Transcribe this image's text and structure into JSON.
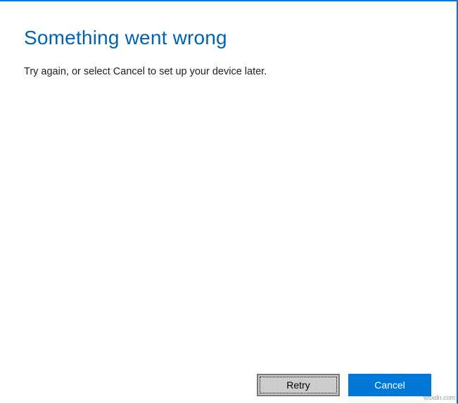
{
  "dialog": {
    "title": "Something went wrong",
    "message": "Try again, or select Cancel to set up your device later.",
    "buttons": {
      "retry": "Retry",
      "cancel": "Cancel"
    }
  },
  "watermark": "wsxdn.com"
}
